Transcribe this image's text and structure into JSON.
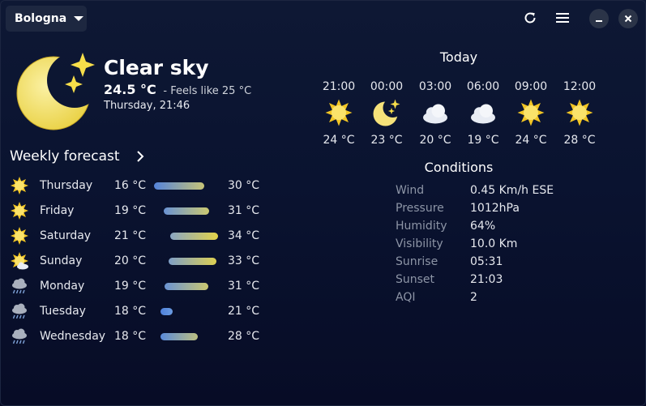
{
  "header": {
    "location": "Bologna"
  },
  "current": {
    "condition": "Clear sky",
    "temperature": "24.5 °C",
    "feels_like": "- Feels like 25 °C",
    "datetime": "Thursday, 21:46",
    "icon": "moon-stars-icon"
  },
  "weekly": {
    "title": "Weekly forecast",
    "days": [
      {
        "name": "Thursday",
        "min": "16  °C",
        "max": "30  °C",
        "icon": "sun-icon"
      },
      {
        "name": "Friday",
        "min": "19  °C",
        "max": "31  °C",
        "icon": "sun-icon"
      },
      {
        "name": "Saturday",
        "min": "21  °C",
        "max": "34  °C",
        "icon": "sun-icon"
      },
      {
        "name": "Sunday",
        "min": "20  °C",
        "max": "33  °C",
        "icon": "sun-cloud-icon"
      },
      {
        "name": "Monday",
        "min": "19  °C",
        "max": "31  °C",
        "icon": "rain-cloud-icon"
      },
      {
        "name": "Tuesday",
        "min": "18  °C",
        "max": "21  °C",
        "icon": "rain-cloud-icon"
      },
      {
        "name": "Wednesday",
        "min": "18  °C",
        "max": "28  °C",
        "icon": "rain-cloud-icon"
      }
    ]
  },
  "today": {
    "title": "Today",
    "hours": [
      {
        "time": "21:00",
        "temp": "24  °C",
        "icon": "sun-icon"
      },
      {
        "time": "00:00",
        "temp": "23  °C",
        "icon": "moon-stars-icon"
      },
      {
        "time": "03:00",
        "temp": "20  °C",
        "icon": "cloud-icon"
      },
      {
        "time": "06:00",
        "temp": "19  °C",
        "icon": "cloud-icon"
      },
      {
        "time": "09:00",
        "temp": "24  °C",
        "icon": "sun-icon"
      },
      {
        "time": "12:00",
        "temp": "28  °C",
        "icon": "sun-icon"
      }
    ]
  },
  "conditions": {
    "title": "Conditions",
    "rows": [
      {
        "label": "Wind",
        "value": "0.45 Km/h ESE"
      },
      {
        "label": "Pressure",
        "value": "1012hPa"
      },
      {
        "label": "Humidity",
        "value": "64%"
      },
      {
        "label": "Visibility",
        "value": "10.0  Km"
      },
      {
        "label": "Sunrise",
        "value": "05:31"
      },
      {
        "label": "Sunset",
        "value": "21:03"
      },
      {
        "label": "AQI",
        "value": "2"
      }
    ]
  },
  "colors": {
    "background": "#0a1330",
    "bar_cool": "#4e7fd8",
    "bar_warm": "#e6d24a",
    "sun": "#f7d23a",
    "moon": "#f6e27a"
  }
}
